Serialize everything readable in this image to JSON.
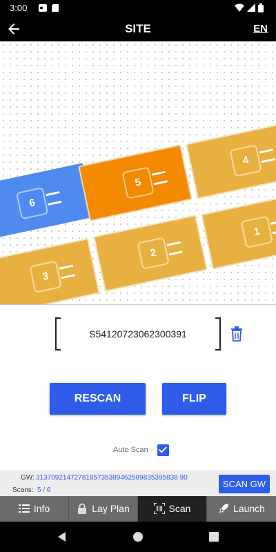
{
  "status_bar": {
    "time": "3:00"
  },
  "app_bar": {
    "title": "SITE",
    "language": "EN"
  },
  "layout": {
    "panels": [
      {
        "number": "6",
        "color": "#4f8af0"
      },
      {
        "number": "5",
        "color": "#f48a00",
        "selected": true
      },
      {
        "number": "4",
        "color": "#e8b040"
      },
      {
        "number": "3",
        "color": "#e8b040"
      },
      {
        "number": "2",
        "color": "#e8b040"
      },
      {
        "number": "1",
        "color": "#e8b040"
      }
    ]
  },
  "scan": {
    "value": "S54120723062300391"
  },
  "buttons": {
    "rescan": "RESCAN",
    "flip": "FLIP"
  },
  "auto_scan": {
    "label": "Auto Scan",
    "checked": true
  },
  "gateway": {
    "gw_label": "GW:",
    "gw_value": "3137092147278185735389462589835395838 90",
    "scans_label": "Scans:",
    "scans_value": "5 / 6",
    "scan_gw_button": "SCAN GW"
  },
  "tabs": [
    {
      "label": "Info",
      "icon": "list-icon",
      "active": false
    },
    {
      "label": "Lay Plan",
      "icon": "lock-icon",
      "active": false
    },
    {
      "label": "Scan",
      "icon": "barcode-scan-icon",
      "active": true
    },
    {
      "label": "Launch",
      "icon": "rocket-icon",
      "active": false
    }
  ],
  "colors": {
    "accent": "#2f5ce8",
    "app_bar": "#000000",
    "tab_bar": "#6b6b6b",
    "tab_active": "#222222"
  }
}
